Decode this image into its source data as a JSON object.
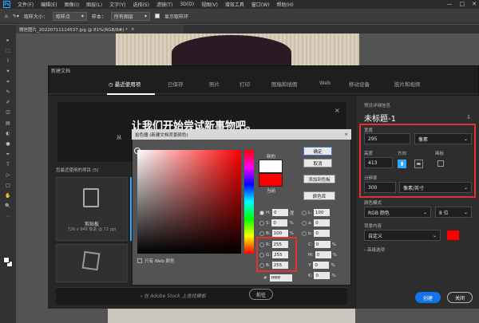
{
  "menubar": {
    "logo": "Ps",
    "items": [
      "文件(F)",
      "编辑(E)",
      "图像(I)",
      "图层(L)",
      "文字(Y)",
      "选择(S)",
      "滤镜(T)",
      "3D(D)",
      "视图(V)",
      "增效工具",
      "窗口(W)",
      "帮助(H)"
    ],
    "window_controls": [
      "—",
      "□",
      "✕"
    ]
  },
  "optionsbar": {
    "sample_size_label": "取样大小：",
    "sample_size_value": "取样点",
    "sample_label": "样本：",
    "sample_value": "所有图层",
    "show_ring_label": "显示取样环"
  },
  "document_tab": {
    "title": "微信图片_20220711114537.jpg @ 81%(RGB/8#) *",
    "close": "×"
  },
  "toolbar": {
    "tools": [
      "▸",
      "⬚",
      "⌇",
      "✦",
      "⌗",
      "✎",
      "✐",
      "⎚",
      "▤",
      "◐",
      "●",
      "✒",
      "T",
      "▷",
      "□",
      "✋",
      "🔍",
      "⋯"
    ]
  },
  "new_doc": {
    "title": "新建文档",
    "tabs": [
      "最近使用项",
      "已保存",
      "照片",
      "打印",
      "图稿和插图",
      "Web",
      "移动设备",
      "胶片和视频"
    ],
    "active_tab": 0,
    "hero_title": "让我们开始尝试新事物吧。",
    "hero_sub": "从",
    "hero_close": "×",
    "recent_label": "您最近使用的项目",
    "recent_count": "(5)",
    "card1_name": "剪贴板",
    "card1_size": "726 x 946 像素 @ 72 ppi",
    "search_text": "在 Adobe Stock 上查找模板",
    "goto_label": "前往",
    "preset_label": "预设详细信息",
    "doc_name": "未标题-1",
    "save_preset_icon": "⇩",
    "width_label": "宽度",
    "width_value": "295",
    "width_unit": "像素",
    "height_label": "高度",
    "height_value": "413",
    "orientation_label": "方向",
    "artboard_label": "画板",
    "resolution_label": "分辨率",
    "resolution_value": "300",
    "resolution_unit": "像素/英寸",
    "colormode_label": "颜色模式",
    "colormode_value": "RGB 颜色",
    "bitdepth_value": "8 位",
    "bgcontent_label": "背景内容",
    "bgcontent_value": "自定义",
    "bg_color": "#ff0000",
    "advanced_label": "高级选项",
    "create_label": "创建",
    "close_label": "关闭"
  },
  "picker": {
    "title": "拾色器 (新建文档背景颜色)",
    "close": "×",
    "new_label": "新的",
    "current_label": "当前",
    "new_color": "#ffffff",
    "current_color": "#ff0000",
    "ok": "确定",
    "cancel": "取消",
    "add_swatch": "添加到色板",
    "color_lib": "颜色库",
    "web_only": "只有 Web 颜色",
    "fields": {
      "H": {
        "value": "0",
        "unit": "度"
      },
      "S": {
        "value": "0",
        "unit": "%"
      },
      "B": {
        "value": "100",
        "unit": "%"
      },
      "R": {
        "value": "255"
      },
      "G": {
        "value": "255"
      },
      "Bb": {
        "value": "255"
      },
      "L": {
        "value": "100"
      },
      "a": {
        "value": "0"
      },
      "b": {
        "value": "0"
      },
      "C": {
        "value": "0",
        "unit": "%"
      },
      "M": {
        "value": "0",
        "unit": "%"
      },
      "Y": {
        "value": "0",
        "unit": "%"
      },
      "K": {
        "value": "0",
        "unit": "%"
      },
      "hex_label": "#",
      "hex": "ffffff"
    }
  }
}
